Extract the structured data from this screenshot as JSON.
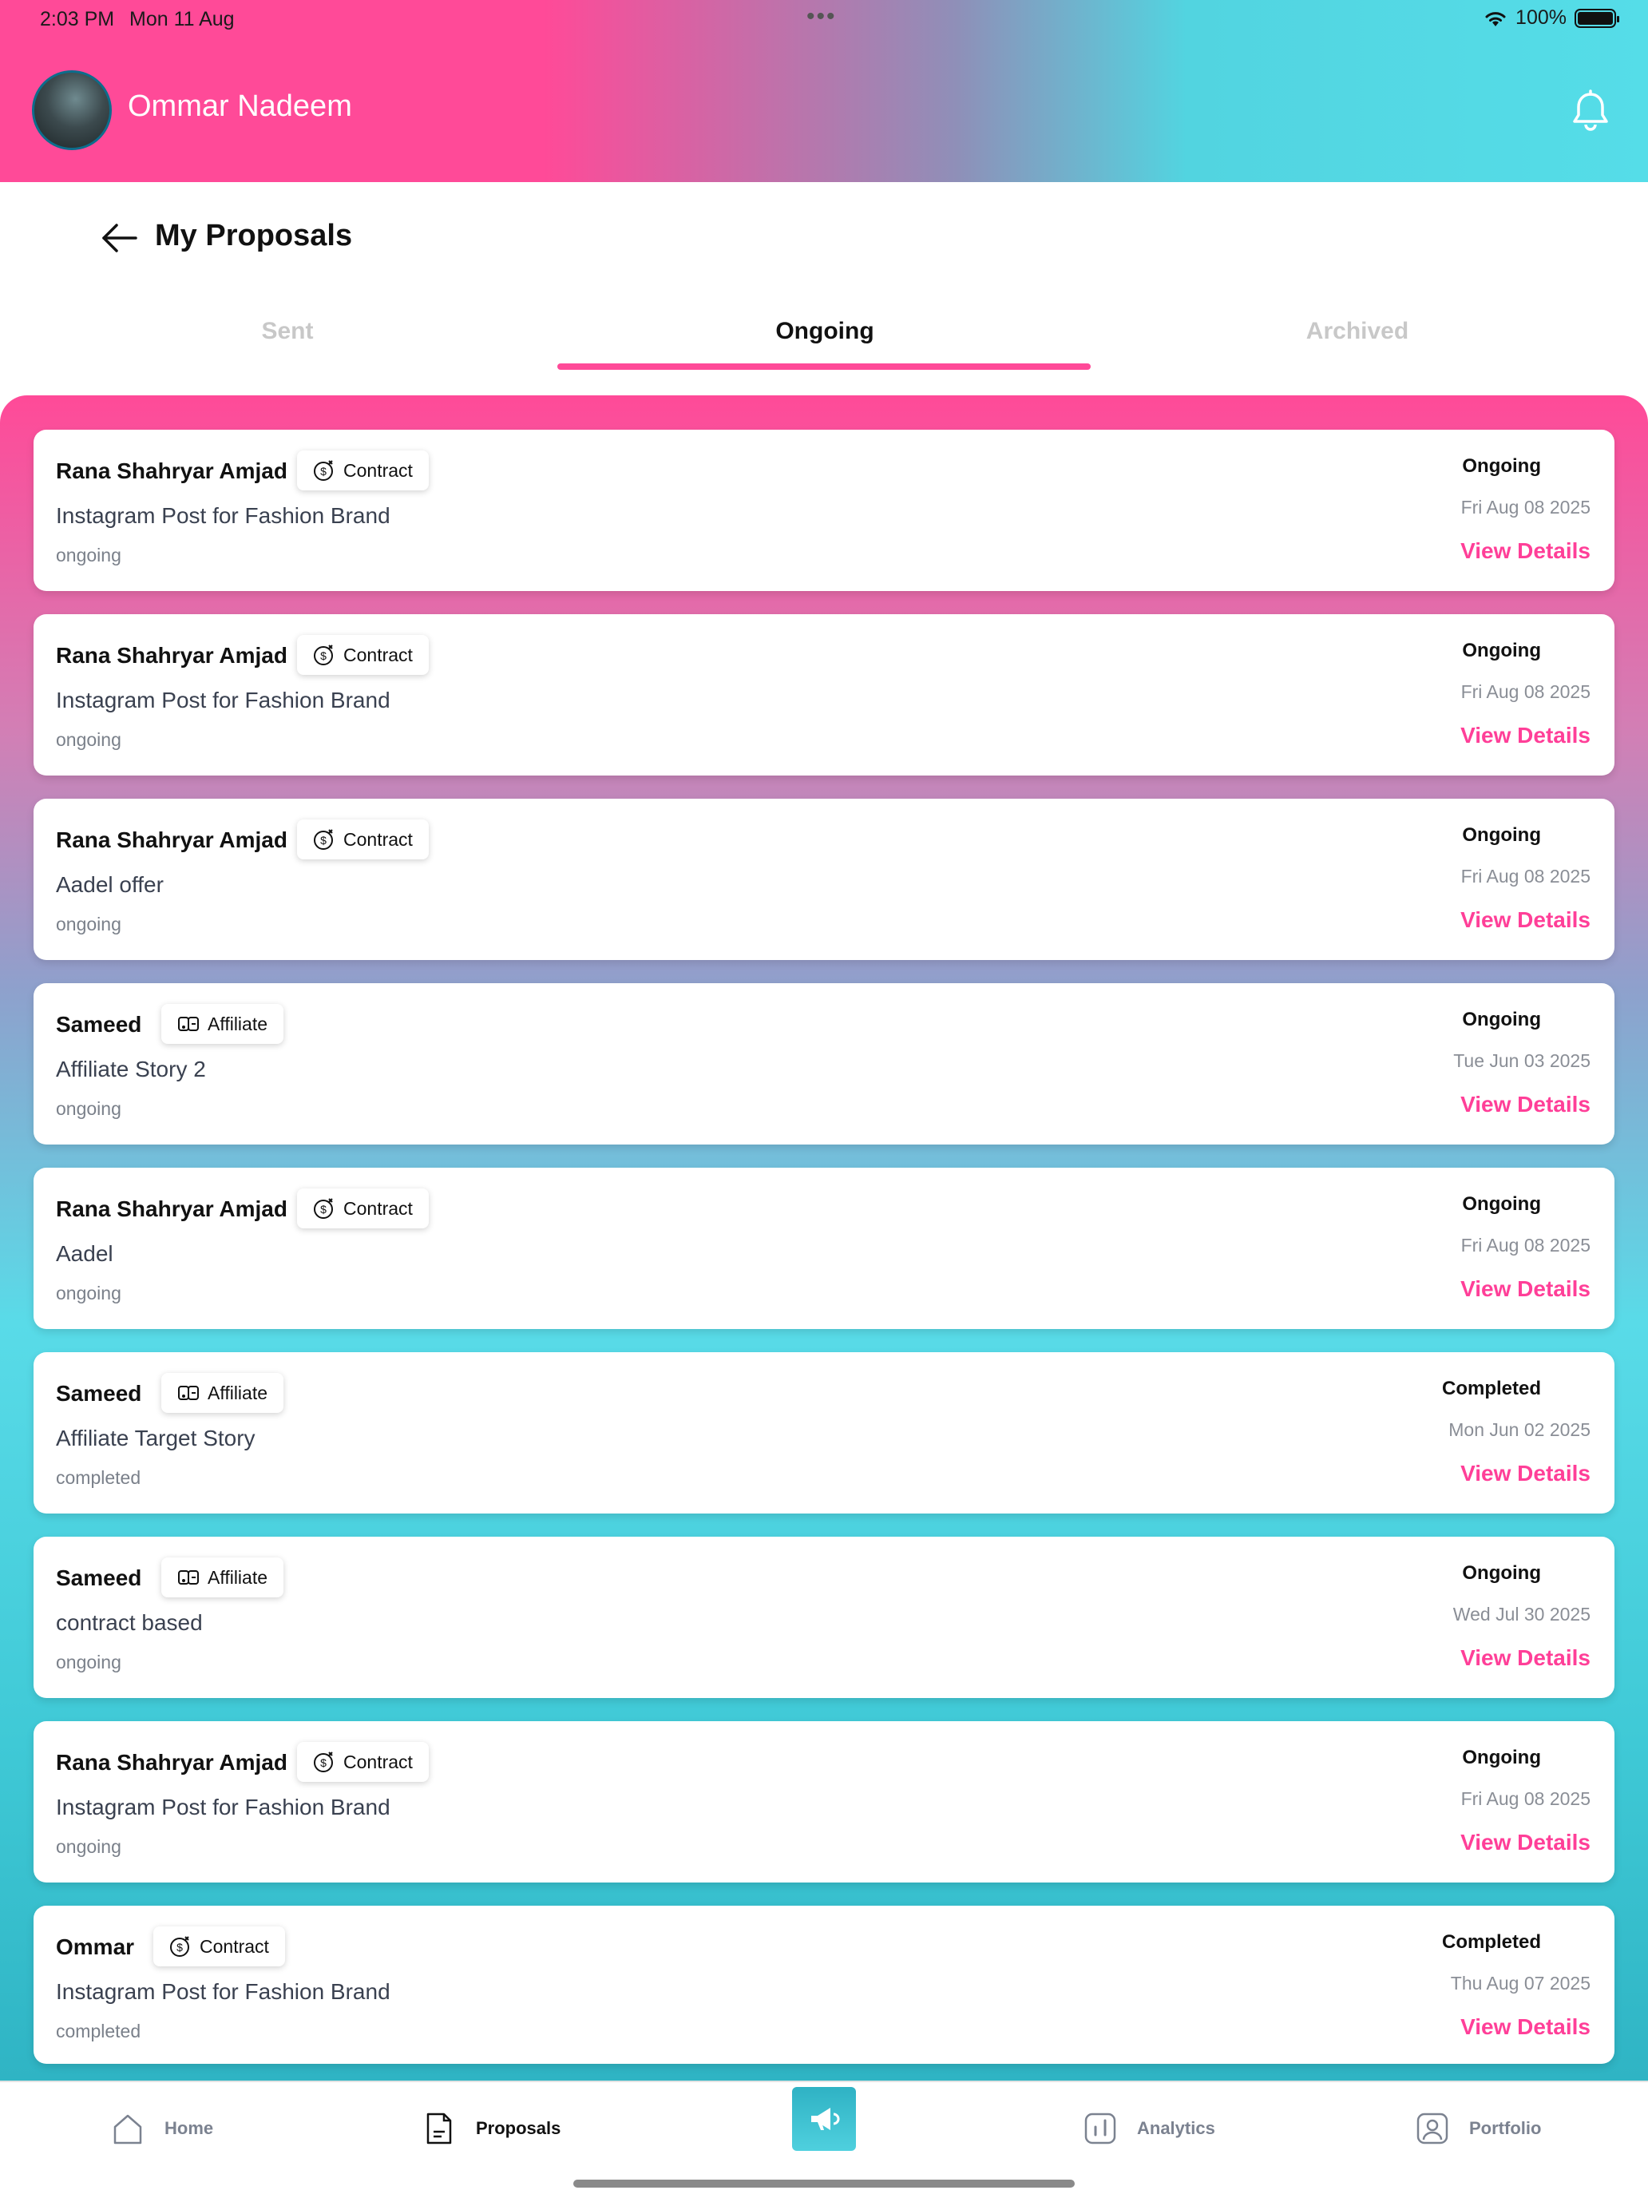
{
  "status_bar": {
    "time": "2:03 PM",
    "date": "Mon 11 Aug",
    "battery": "100%"
  },
  "header": {
    "user_name": "Ommar Nadeem"
  },
  "page": {
    "title": "My Proposals"
  },
  "tabs": {
    "sent": "Sent",
    "ongoing": "Ongoing",
    "archived": "Archived",
    "active": "Ongoing"
  },
  "cards": [
    {
      "name": "Rana Shahryar Amjad",
      "badge": "Contract",
      "badge_icon": "dollar-coin-icon",
      "title": "Instagram Post for Fashion Brand",
      "sub": "ongoing",
      "status": "Ongoing",
      "date": "Fri Aug 08 2025",
      "action": "View Details"
    },
    {
      "name": "Rana Shahryar Amjad",
      "badge": "Contract",
      "badge_icon": "dollar-coin-icon",
      "title": "Instagram Post for Fashion Brand",
      "sub": "ongoing",
      "status": "Ongoing",
      "date": "Fri Aug 08 2025",
      "action": "View Details"
    },
    {
      "name": "Rana Shahryar Amjad",
      "badge": "Contract",
      "badge_icon": "dollar-coin-icon",
      "title": "Aadel offer",
      "sub": "ongoing",
      "status": "Ongoing",
      "date": "Fri Aug 08 2025",
      "action": "View Details"
    },
    {
      "name": "Sameed",
      "badge": "Affiliate",
      "badge_icon": "affiliate-icon",
      "title": "Affiliate Story 2",
      "sub": "ongoing",
      "status": "Ongoing",
      "date": "Tue Jun 03 2025",
      "action": "View Details"
    },
    {
      "name": "Rana Shahryar Amjad",
      "badge": "Contract",
      "badge_icon": "dollar-coin-icon",
      "title": "Aadel",
      "sub": "ongoing",
      "status": "Ongoing",
      "date": "Fri Aug 08 2025",
      "action": "View Details"
    },
    {
      "name": "Sameed",
      "badge": "Affiliate",
      "badge_icon": "affiliate-icon",
      "title": "Affiliate Target Story",
      "sub": "completed",
      "status": "Completed",
      "date": "Mon Jun 02 2025",
      "action": "View Details"
    },
    {
      "name": "Sameed",
      "badge": "Affiliate",
      "badge_icon": "affiliate-icon",
      "title": "contract based",
      "sub": "ongoing",
      "status": "Ongoing",
      "date": "Wed Jul 30 2025",
      "action": "View Details"
    },
    {
      "name": "Rana Shahryar Amjad",
      "badge": "Contract",
      "badge_icon": "dollar-coin-icon",
      "title": "Instagram Post for Fashion Brand",
      "sub": "ongoing",
      "status": "Ongoing",
      "date": "Fri Aug 08 2025",
      "action": "View Details"
    },
    {
      "name": "Ommar",
      "badge": "Contract",
      "badge_icon": "dollar-coin-icon",
      "title": "Instagram Post for Fashion Brand",
      "sub": "completed",
      "status": "Completed",
      "date": "Thu Aug 07 2025",
      "action": "View Details"
    }
  ],
  "nav": {
    "home": "Home",
    "proposals": "Proposals",
    "analytics": "Analytics",
    "portfolio": "Portfolio",
    "active": "Proposals"
  },
  "colors": {
    "accent": "#ff4a98",
    "teal": "#4fd0de",
    "link": "#ff3f98"
  }
}
